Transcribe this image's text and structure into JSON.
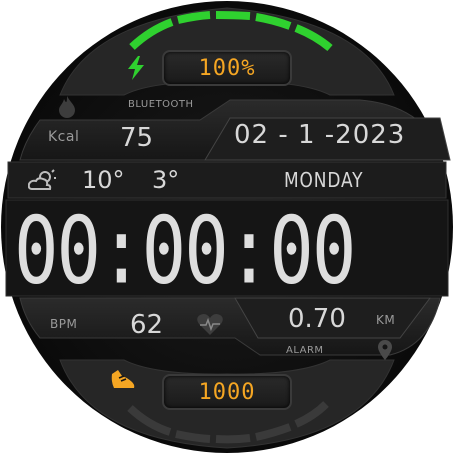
{
  "battery": {
    "percent_label": "100%",
    "level_fraction": 1.0
  },
  "labels": {
    "bluetooth": "BLUETOOTH",
    "kcal": "Kcal",
    "bpm": "BPM",
    "alarm": "ALARM",
    "km": "KM"
  },
  "stats": {
    "kcal_value": "75",
    "bpm_value": "62",
    "distance_value": "0.70",
    "steps_value": "1000"
  },
  "date": {
    "text": "02 - 1 -2023",
    "weekday": "MONDAY"
  },
  "weather": {
    "temp_high": "10°",
    "temp_low": "3°"
  },
  "time": {
    "display": "00:00:00"
  },
  "colors": {
    "accent_green": "#2fd12f",
    "accent_orange": "#f5a623",
    "background": "#111111"
  },
  "icons": {
    "battery": "lightning-icon",
    "heat": "flame-icon",
    "weather": "partly-cloudy-icon",
    "heart": "heart-pulse-icon",
    "location": "location-pin-icon",
    "steps": "shoe-icon"
  },
  "steps_progress": {
    "level_fraction": 0.0
  }
}
